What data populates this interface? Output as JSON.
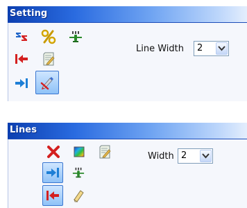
{
  "panels": {
    "setting": {
      "title": "Setting",
      "line_width_label": "Line Width",
      "line_width_value": "2",
      "tool_icons": [
        "sort-descending-icon",
        "percent-icon",
        "decimal-places-icon",
        "arrow-left-icon",
        "edit-page-icon",
        "arrow-right-icon",
        "marker-pen-icon"
      ],
      "active_tool": "marker-pen-icon"
    },
    "lines": {
      "title": "Lines",
      "width_label": "Width",
      "width_value": "2",
      "tool_icons": [
        "delete-x-icon",
        "color-gradient-icon",
        "edit-page-icon",
        "arrow-right-icon",
        "decimal-places-icon",
        "arrow-left-icon",
        "eraser-icon"
      ],
      "active_tools": [
        "arrow-right-icon",
        "arrow-left-icon"
      ]
    }
  },
  "colors": {
    "title_bar": "#2a6be0",
    "panel_bg": "#f5f7fc",
    "active_button": "#8fc2f7",
    "red_icon": "#d42020",
    "blue_icon": "#1e7fd6"
  }
}
